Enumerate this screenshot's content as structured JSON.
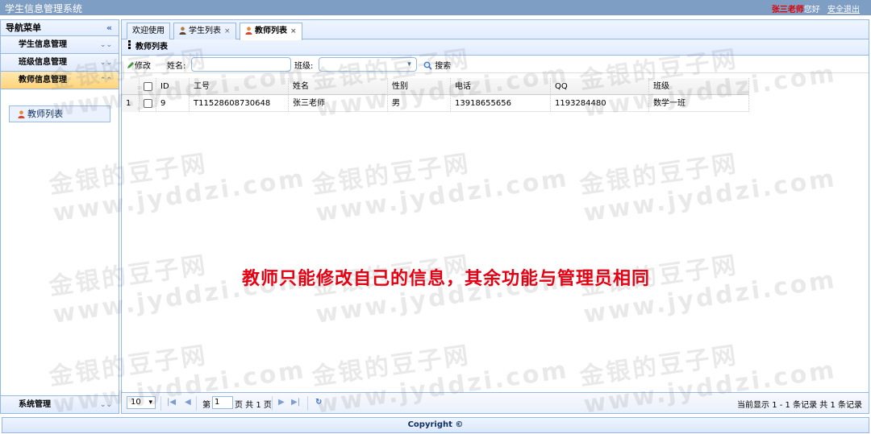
{
  "app": {
    "title": "学生信息管理系统"
  },
  "user": {
    "name": "张三老师",
    "greeting": "您好",
    "logout": "安全退出"
  },
  "sidebar": {
    "header": "导航菜单",
    "groups": [
      {
        "label": "学生信息管理"
      },
      {
        "label": "班级信息管理"
      },
      {
        "label": "教师信息管理"
      }
    ],
    "active_items": [
      {
        "label": "教师列表"
      }
    ],
    "footer": "系统管理"
  },
  "tabs": [
    {
      "label": "欢迎使用"
    },
    {
      "label": "学生列表"
    },
    {
      "label": "教师列表"
    }
  ],
  "panel": {
    "title": "教师列表"
  },
  "toolbar": {
    "edit_label": "修改",
    "name_label": "姓名:",
    "name_value": "",
    "class_label": "班级:",
    "class_value": "",
    "search_label": "搜索"
  },
  "table": {
    "columns": [
      "ID",
      "工号",
      "姓名",
      "性别",
      "电话",
      "QQ",
      "班级"
    ],
    "rows": [
      {
        "rownum": "1",
        "id": "9",
        "sn": "T11528608730648",
        "name": "张三老师",
        "sex": "男",
        "phone": "13918655656",
        "qq": "1193284480",
        "clazz": "数学一班"
      }
    ]
  },
  "pager": {
    "page_size": "10",
    "page_label_before": "第",
    "page_value": "1",
    "page_label_after": "页 共 1 页",
    "summary": "当前显示 1 - 1 条记录 共 1 条记录"
  },
  "footer": {
    "text": "Copyright ©"
  },
  "annotation": {
    "text": "教师只能修改自己的信息，其余功能与管理员相同"
  },
  "watermark": {
    "line1": "金银的豆子网",
    "line2": "www.jyddzi.com"
  },
  "colors": {
    "accent": "#7f9ec3",
    "border": "#95b8e7",
    "annotation": "#e60012",
    "username": "#e00000"
  },
  "icons": [
    "collapse-icon",
    "chevron-down-icon",
    "chevron-up-icon",
    "teacher-icon",
    "student-icon",
    "pencil-icon",
    "search-icon",
    "first-page-icon",
    "prev-page-icon",
    "next-page-icon",
    "last-page-icon",
    "refresh-icon"
  ]
}
